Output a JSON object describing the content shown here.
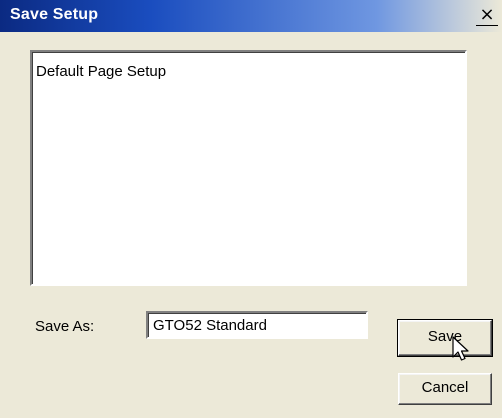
{
  "window": {
    "title": "Save Setup",
    "close_glyph": "×"
  },
  "list": {
    "items": [
      "Default Page Setup"
    ]
  },
  "save_as": {
    "label": "Save As:",
    "value": "GTO52 Standard"
  },
  "buttons": {
    "save_label": "Save",
    "cancel_label": "Cancel"
  },
  "colors": {
    "title_bar_start": "#0b2a82",
    "title_bar_end": "#ece9d8",
    "dialog_bg": "#ece9d8"
  }
}
